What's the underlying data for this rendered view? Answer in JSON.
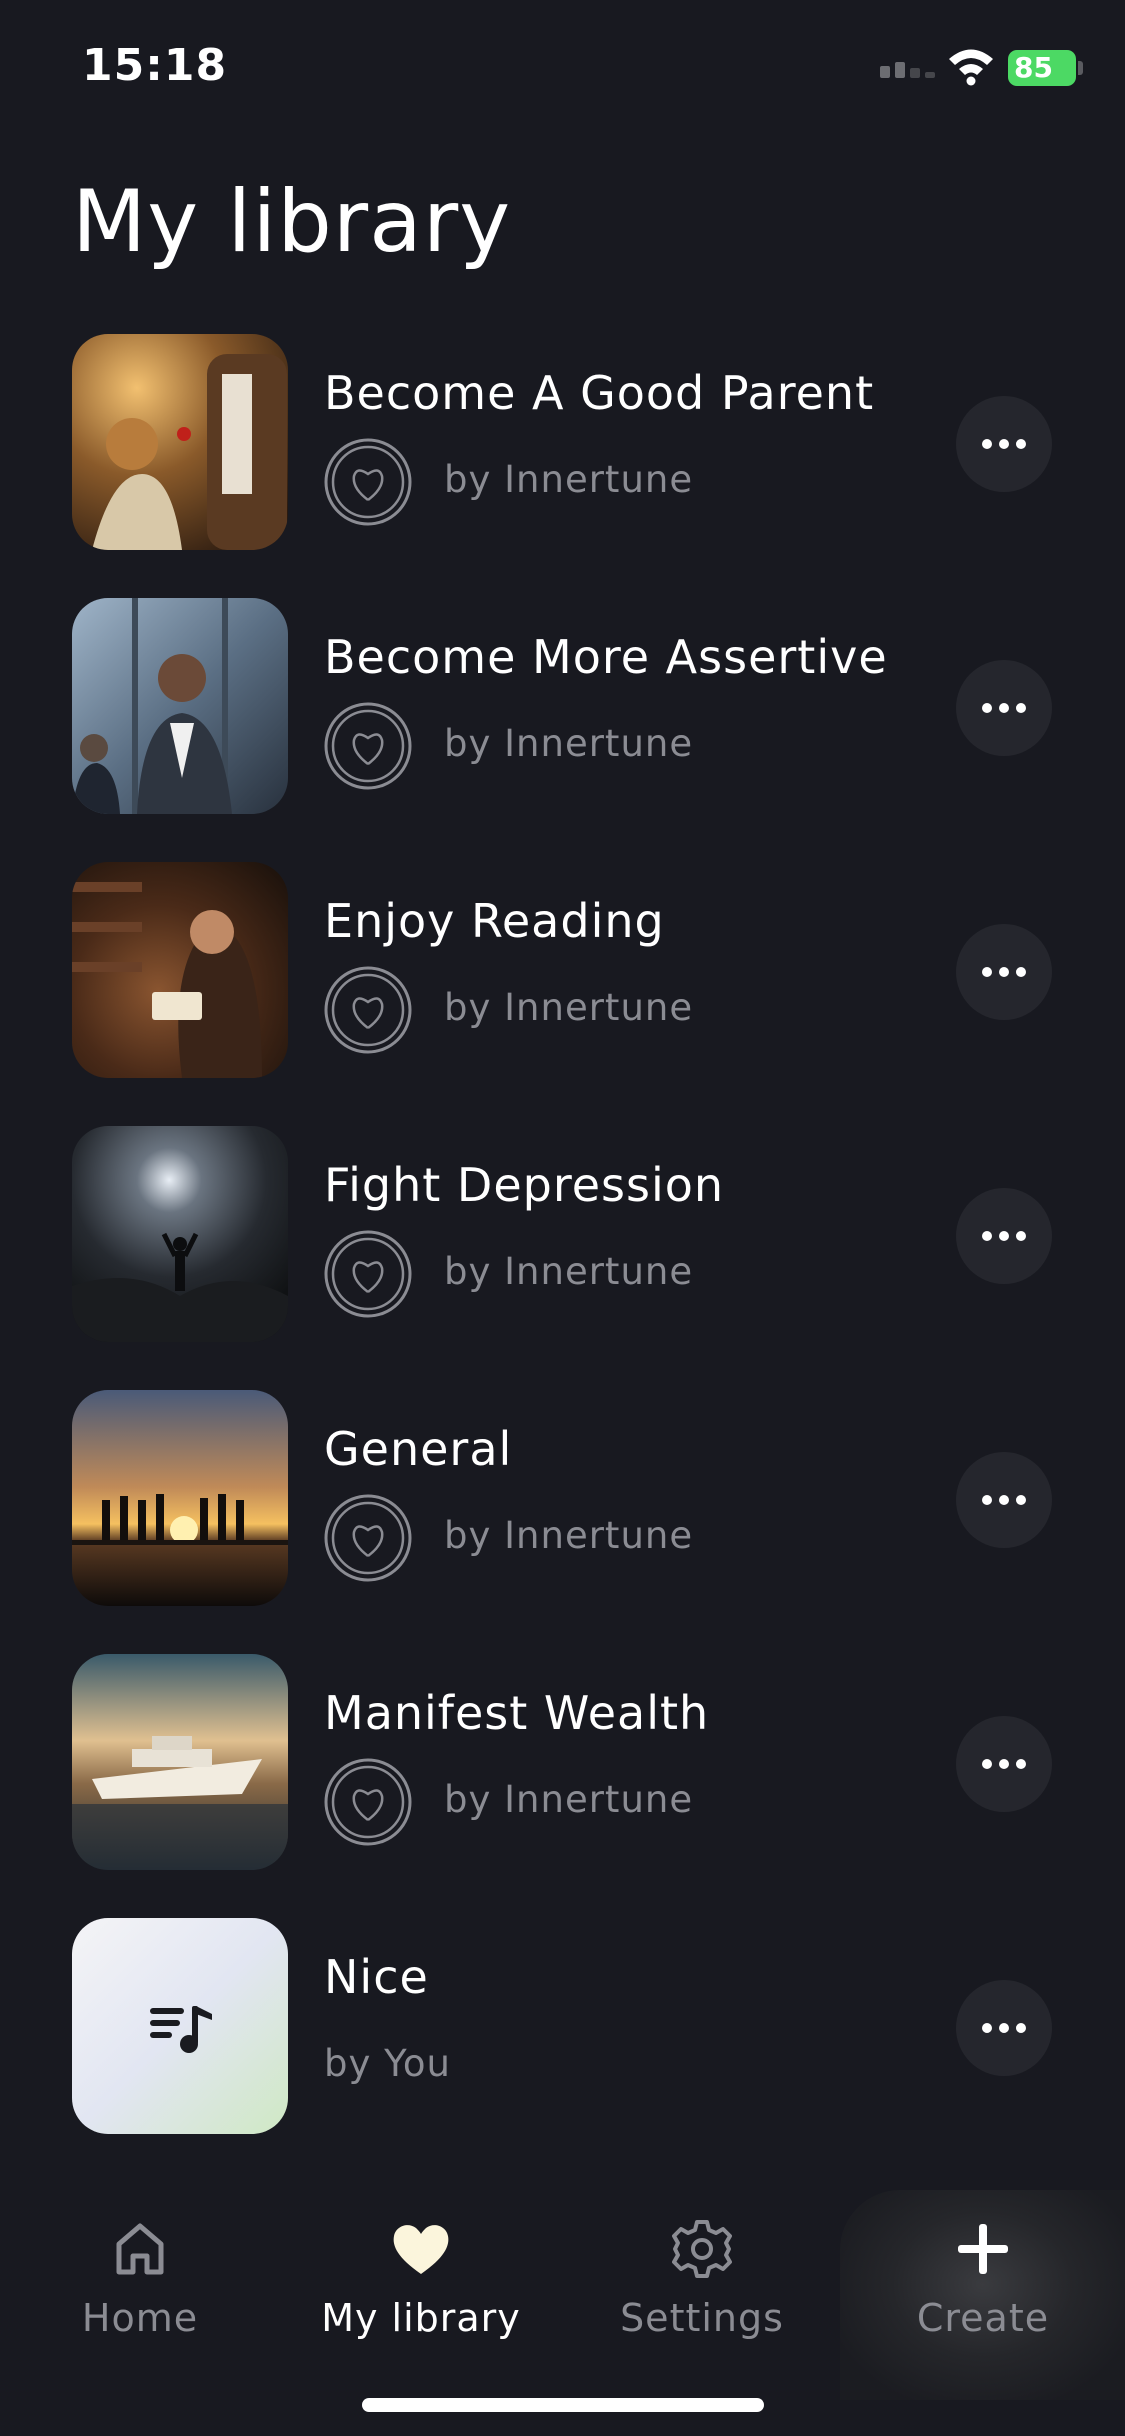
{
  "status_bar": {
    "time": "15:18",
    "battery": "85"
  },
  "page": {
    "title": "My library"
  },
  "items": [
    {
      "title": "Become A Good Parent",
      "author": "by Innertune"
    },
    {
      "title": "Become More Assertive",
      "author": "by Innertune"
    },
    {
      "title": "Enjoy Reading",
      "author": "by Innertune"
    },
    {
      "title": "Fight Depression",
      "author": "by Innertune"
    },
    {
      "title": "General",
      "author": "by Innertune"
    },
    {
      "title": "Manifest Wealth",
      "author": "by Innertune"
    },
    {
      "title": "Nice",
      "author": "by You"
    }
  ],
  "tab_bar": {
    "tabs": [
      {
        "label": "Home",
        "icon": "home-icon"
      },
      {
        "label": "My library",
        "icon": "heart-icon",
        "active": true
      },
      {
        "label": "Settings",
        "icon": "gear-icon"
      },
      {
        "label": "Create",
        "icon": "plus-icon"
      }
    ]
  },
  "colors": {
    "background": "#181920",
    "secondary_text": "#8b8c93",
    "battery": "#4cd964"
  }
}
